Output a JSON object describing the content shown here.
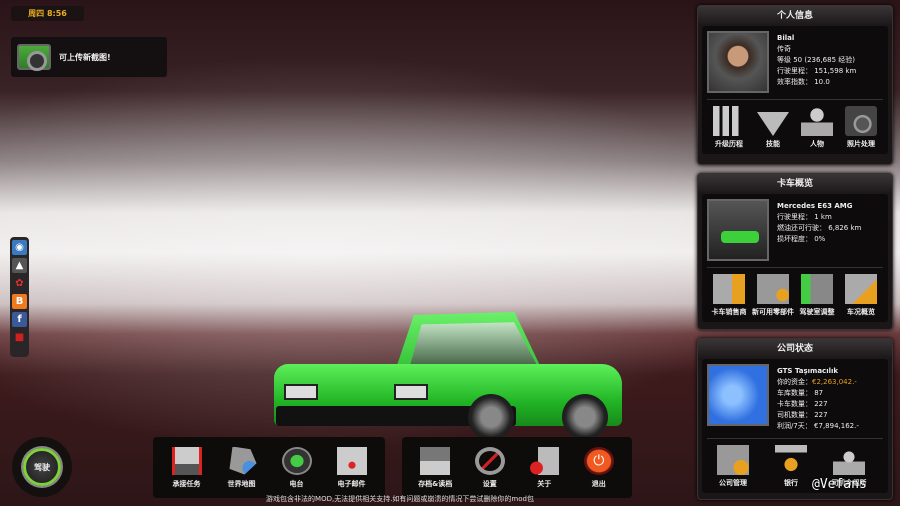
{
  "clock": "周四 8:56",
  "toast": "可上传新截图!",
  "drive_label": "驾驶",
  "social": [
    "online-icon",
    "steam-workshop-icon",
    "promods-icon",
    "blogger-icon",
    "facebook-icon",
    "feedback-icon"
  ],
  "profile": {
    "title": "个人信息",
    "name": "Bilal",
    "rank": "传奇",
    "level": "等级 50 (236,685 经验)",
    "distance": "行驶里程： 151,598 km",
    "efficiency": "效率指数： 10.0",
    "actions": [
      "升级历程",
      "技能",
      "人物",
      "照片处理"
    ]
  },
  "truck": {
    "title": "卡车概览",
    "model": "Mercedes E63 AMG",
    "distance": "行驶里程： 1 km",
    "fuel_range": "燃油还可行驶： 6,826 km",
    "damage": "损坏程度： 0%",
    "actions": [
      "卡车销售商",
      "新可用零部件",
      "驾驶室调整",
      "车况概览"
    ]
  },
  "company": {
    "title": "公司状态",
    "name": "GTS Taşımacılık",
    "money_label": "你的资金：",
    "money": "€2,263,042.-",
    "garages": "车库数量： 87",
    "trucks": "卡车数量： 227",
    "drivers": "司机数量： 227",
    "profit": "利润/7天： €7,894,162.-",
    "actions": [
      "公司管理",
      "银行",
      "司机介绍所"
    ]
  },
  "menu_left": [
    "承接任务",
    "世界地图",
    "电台",
    "电子邮件"
  ],
  "menu_right": [
    "存档&读档",
    "设置",
    "关于",
    "退出"
  ],
  "footer": "游戏包含非法的MOD,无法提供相关支持.如有问题或崩溃的情况下尝试删除你的mod包",
  "watermark": "@Vefans",
  "colors": {
    "accent_green": "#7fd03a",
    "money": "#e8a020"
  }
}
